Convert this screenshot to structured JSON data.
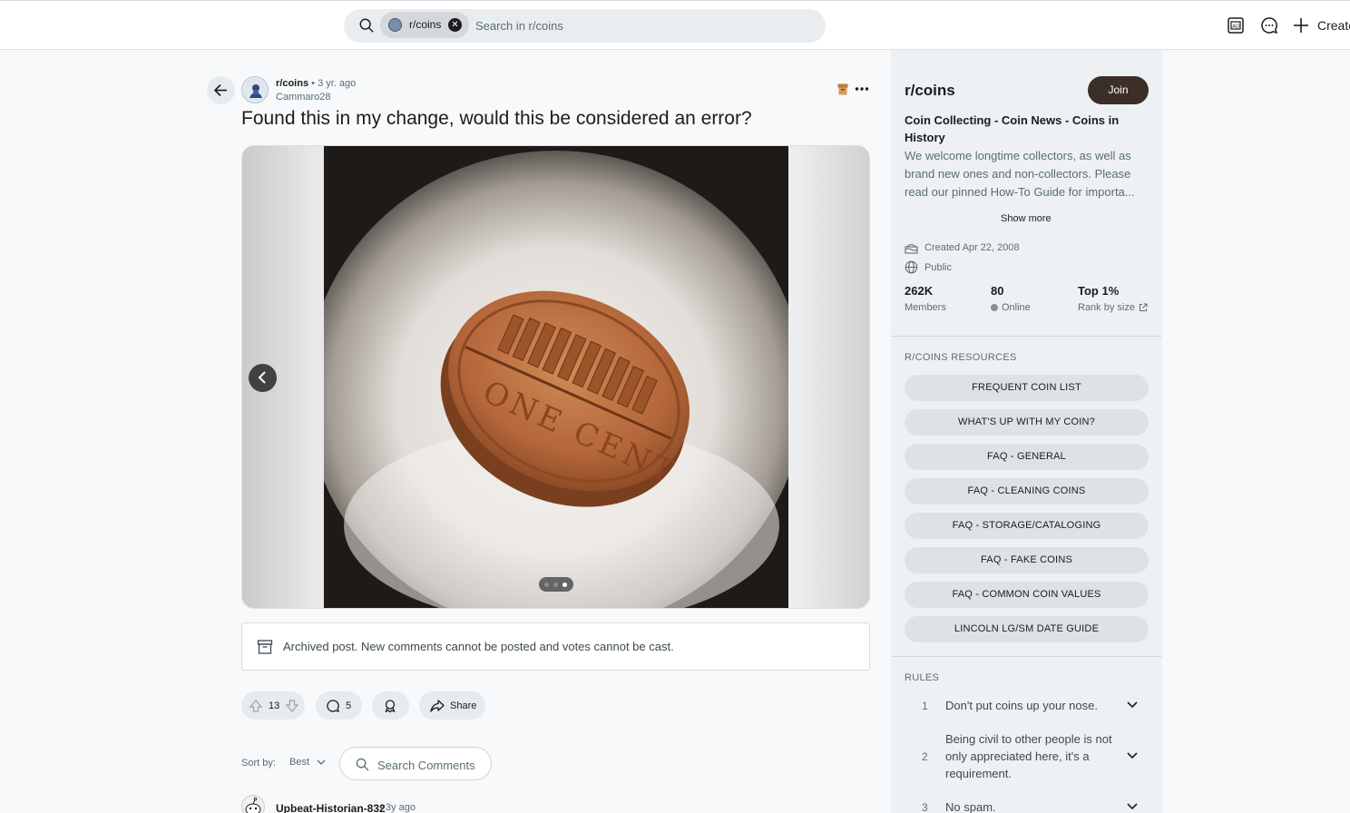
{
  "header": {
    "search": {
      "chip_label": "r/coins",
      "placeholder": "Search in r/coins"
    },
    "create_label": "Create"
  },
  "post": {
    "subreddit": "r/coins",
    "separator": "•",
    "age": "3 yr. ago",
    "author": "Cammaro28",
    "title": "Found this in my change, would this be considered an error?",
    "gallery": {
      "current": 3,
      "total": 3
    },
    "archived_notice": "Archived post. New comments cannot be posted and votes cannot be cast.",
    "votes": "13",
    "comments": "5",
    "share_label": "Share"
  },
  "comments": {
    "sort_label": "Sort by:",
    "sort_value": "Best",
    "search_placeholder": "Search Comments",
    "first": {
      "author": "Upbeat-Historian-832",
      "age": "3y ago"
    }
  },
  "sidebar": {
    "name": "r/coins",
    "join_label": "Join",
    "title": "Coin Collecting - Coin News - Coins in History",
    "description": "We welcome longtime collectors, as well as brand new ones and non-collectors. Please read our pinned How-To Guide for importa...",
    "show_more": "Show more",
    "created": "Created Apr 22, 2008",
    "visibility": "Public",
    "stats": {
      "members_value": "262K",
      "members_label": "Members",
      "online_value": "80",
      "online_label": "Online",
      "rank_value": "Top 1%",
      "rank_label": "Rank by size"
    },
    "resources_heading": "R/COINS RESOURCES",
    "resources": [
      "FREQUENT COIN LIST",
      "WHAT'S UP WITH MY COIN?",
      "FAQ - GENERAL",
      "FAQ - CLEANING COINS",
      "FAQ - STORAGE/CATALOGING",
      "FAQ - FAKE COINS",
      "FAQ - COMMON COIN VALUES",
      "LINCOLN LG/SM DATE GUIDE"
    ],
    "rules_heading": "RULES",
    "rules": [
      {
        "n": "1",
        "text": "Don't put coins up your nose."
      },
      {
        "n": "2",
        "text": "Being civil to other people is not only appreciated here, it's a requirement."
      },
      {
        "n": "3",
        "text": "No spam."
      }
    ]
  },
  "colors": {
    "join_bg": "#3b2f28",
    "pill_bg": "#e5ebee",
    "sidebar_bg": "#eef1f3",
    "coin": "#b9683a"
  }
}
